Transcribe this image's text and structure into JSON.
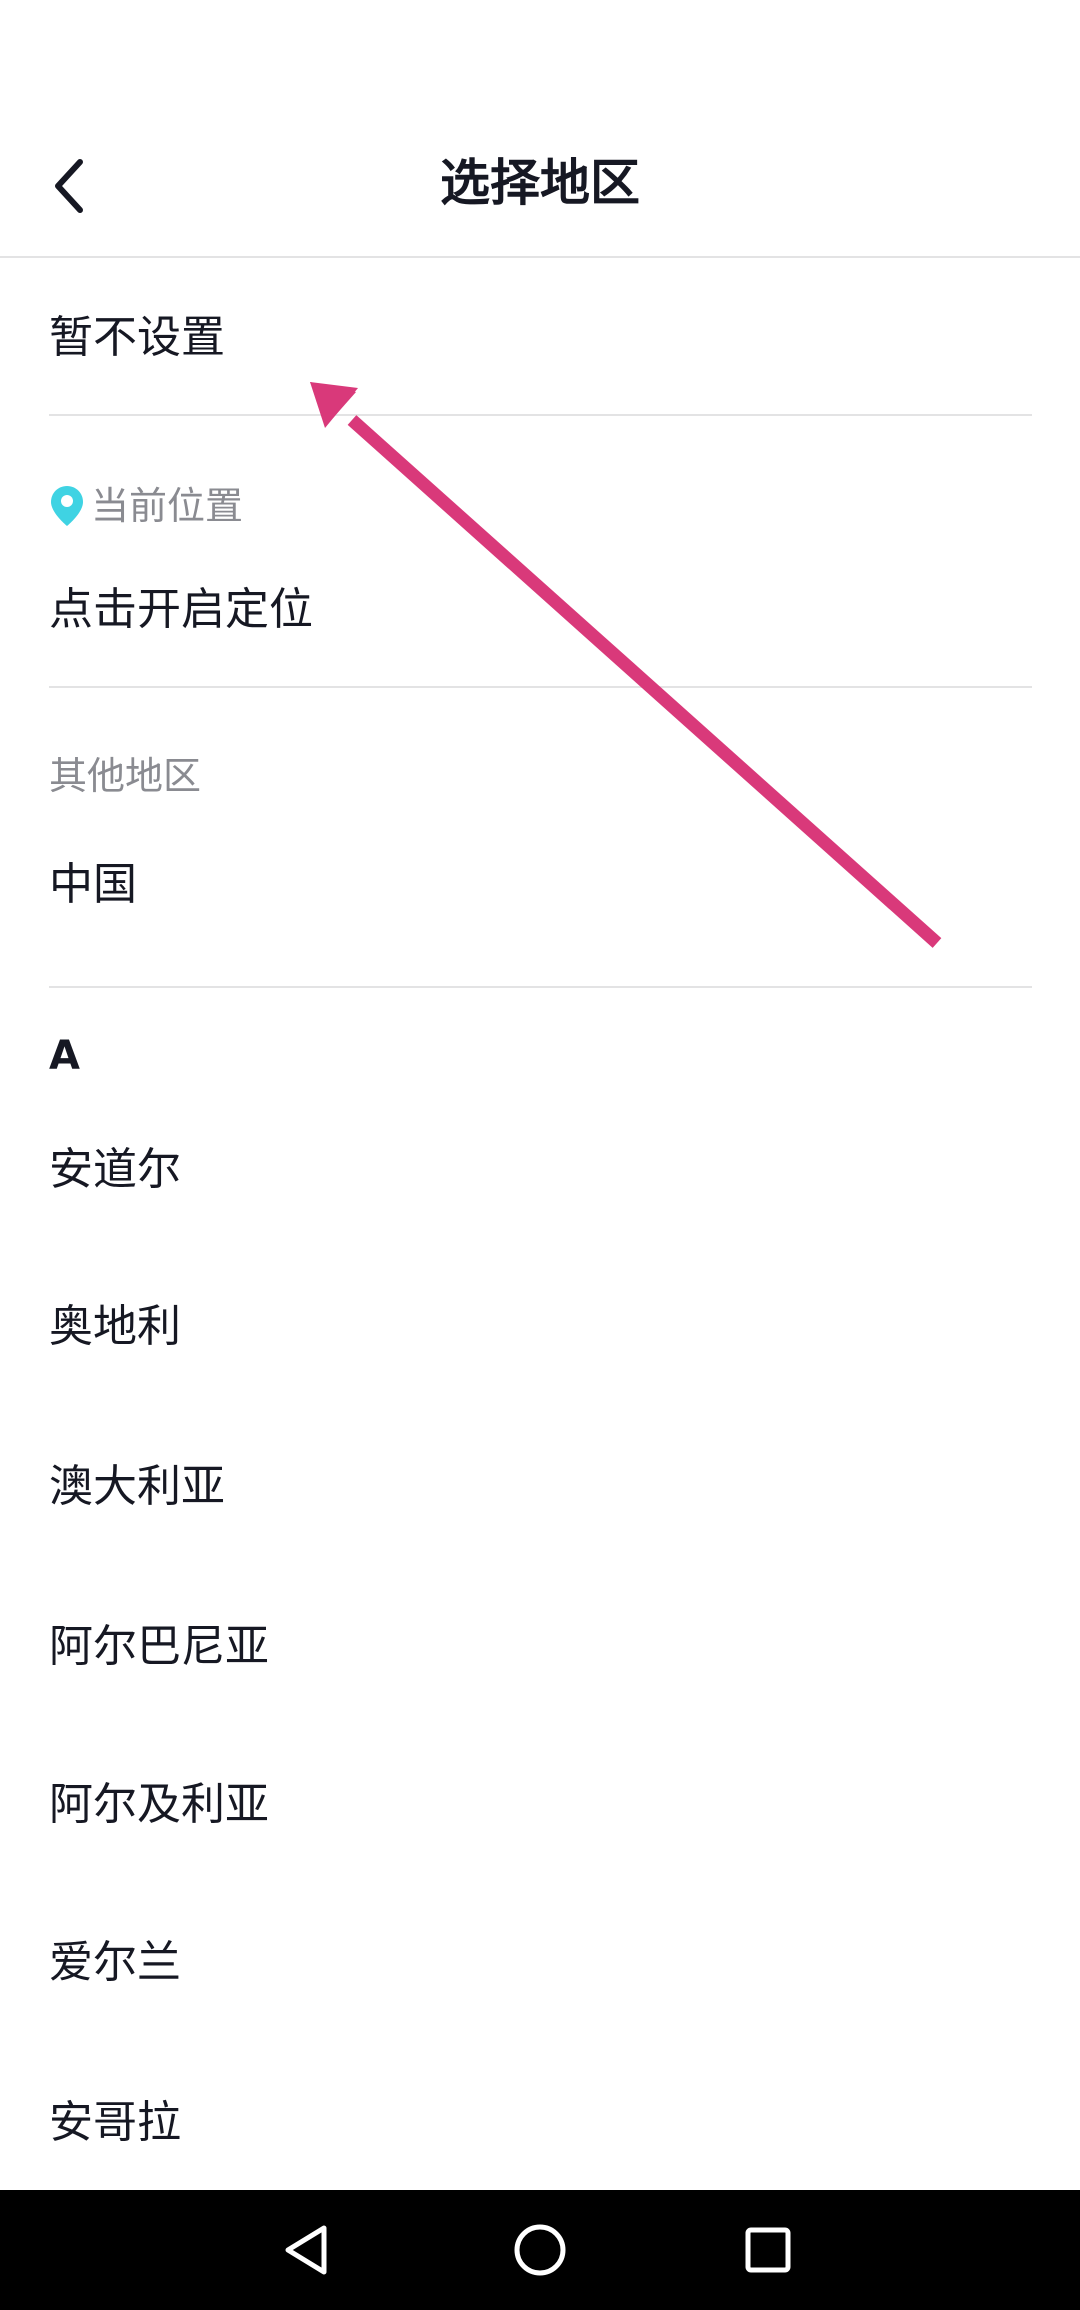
{
  "header": {
    "title": "选择地区",
    "back_icon": "chevron-left-icon"
  },
  "no_setting": {
    "label": "暂不设置"
  },
  "current_location": {
    "section_label": "当前位置",
    "pin_icon": "location-pin-icon",
    "pin_color": "#3fd3e3",
    "action_label": "点击开启定位"
  },
  "other_regions": {
    "section_label": "其他地区",
    "items": [
      "中国"
    ]
  },
  "index_a": {
    "letter": "A",
    "items": [
      "安道尔",
      "奥地利",
      "澳大利亚",
      "阿尔巴尼亚",
      "阿尔及利亚",
      "爱尔兰",
      "安哥拉"
    ]
  },
  "annotation": {
    "arrow_color": "#d9397a"
  },
  "nav_bar": {
    "back_icon": "triangle-back-icon",
    "home_icon": "circle-home-icon",
    "recents_icon": "square-recents-icon"
  }
}
